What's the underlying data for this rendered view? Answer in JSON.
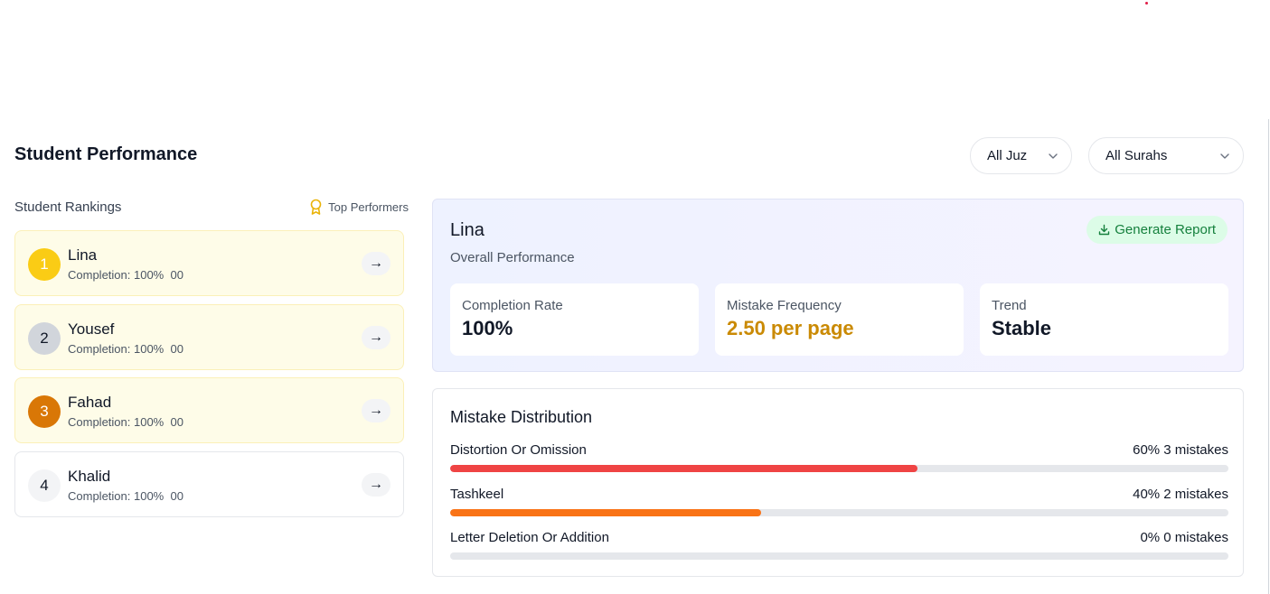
{
  "page": {
    "title": "Student Performance"
  },
  "filters": {
    "juz": "All Juz",
    "surah": "All Surahs"
  },
  "rankings": {
    "title": "Student Rankings",
    "top_performers_label": "Top Performers",
    "students": [
      {
        "rank": "1",
        "name": "Lina",
        "completion": "Completion: 100%",
        "extra": "00"
      },
      {
        "rank": "2",
        "name": "Yousef",
        "completion": "Completion: 100%",
        "extra": "00"
      },
      {
        "rank": "3",
        "name": "Fahad",
        "completion": "Completion: 100%",
        "extra": "00"
      },
      {
        "rank": "4",
        "name": "Khalid",
        "completion": "Completion: 100%",
        "extra": "00"
      }
    ],
    "arrow_glyph": "→"
  },
  "selected": {
    "name": "Lina",
    "subtitle": "Overall Performance",
    "generate_report_label": "Generate Report",
    "stats": [
      {
        "label": "Completion Rate",
        "value": "100%"
      },
      {
        "label": "Mistake Frequency",
        "value": "2.50 per page"
      },
      {
        "label": "Trend",
        "value": "Stable"
      }
    ]
  },
  "distribution": {
    "title": "Mistake Distribution",
    "items": [
      {
        "label": "Distortion Or Omission",
        "summary": "60% 3 mistakes",
        "percent": 60,
        "color": "#ef4444"
      },
      {
        "label": "Tashkeel",
        "summary": "40% 2 mistakes",
        "percent": 40,
        "color": "#f97316"
      },
      {
        "label": "Letter Deletion Or Addition",
        "summary": "0% 0 mistakes",
        "percent": 0,
        "color": "#9ca3af"
      }
    ]
  },
  "colors": {
    "accent_gold": "#facc15",
    "rank_highlight_bg": "#fefce8",
    "report_button_bg": "#dcfce7",
    "warn_value": "#ca8a04"
  }
}
